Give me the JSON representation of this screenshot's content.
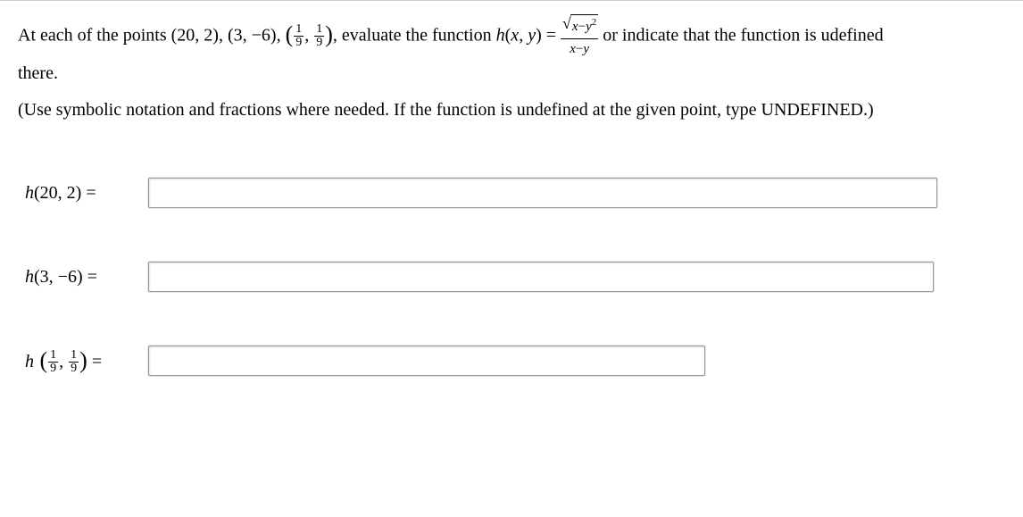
{
  "chart_data": null,
  "prompt": {
    "line1_prefix": "At each of the points ",
    "p1": "(20, 2)",
    "sep": ", ",
    "p2": "(3, −6)",
    "p3_open": "(",
    "p3_num1": "1",
    "p3_den1": "9",
    "p3_comma": ", ",
    "p3_num2": "1",
    "p3_den2": "9",
    "p3_close": ")",
    "line1_mid": ", evaluate the function ",
    "func_name": "h",
    "func_args": "(x, y)",
    "equals": " = ",
    "formula_top_sqrt_inner_x": "x",
    "formula_top_sqrt_inner_minus": "−",
    "formula_top_sqrt_inner_y": "y",
    "formula_top_sqrt_inner_sq": "2",
    "formula_bot_x": "x",
    "formula_bot_minus": "−",
    "formula_bot_y": "y",
    "line1_suffix": " or indicate that the function is udefined",
    "line2": "there.",
    "instructions": "(Use symbolic notation and fractions where needed. If the function is undefined at the given point, type UNDEFINED.)"
  },
  "answers": {
    "row1": {
      "h": "h",
      "args": "(20, 2)",
      "eq": " = ",
      "value": ""
    },
    "row2": {
      "h": "h",
      "args": "(3, −6)",
      "eq": " = ",
      "value": ""
    },
    "row3": {
      "h": "h",
      "open": " (",
      "num1": "1",
      "den1": "9",
      "comma": ", ",
      "num2": "1",
      "den2": "9",
      "close": ")",
      "eq": " = ",
      "value": ""
    }
  }
}
